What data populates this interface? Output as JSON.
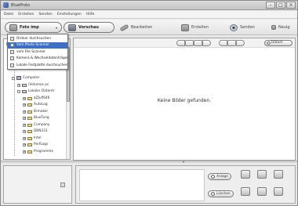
{
  "window": {
    "title": "BlueProto",
    "controls": [
      "–",
      "□",
      "×"
    ]
  },
  "menu": [
    "Datei",
    "Erstellen",
    "Senden",
    "Einstellungen",
    "Hilfe"
  ],
  "toolbar": {
    "import_label": "Foto imp",
    "import_arrow": "▾",
    "view_label": "Vorschau",
    "edit_label": "Bearbeiten",
    "create_label": "Erstellen",
    "send_label": "Senden",
    "more_label": "Neuig"
  },
  "import_menu": [
    {
      "label": "Ordner durchsuchen",
      "selected": false
    },
    {
      "label": "Vom Photo Scanner",
      "selected": true
    },
    {
      "label": "vom File Scanner",
      "selected": false
    },
    {
      "label": "Kamera & Wechseldatenträger",
      "selected": false
    },
    {
      "label": "Lokale Festplatte durchsuchen",
      "selected": false
    }
  ],
  "tree": {
    "computer": "Computer",
    "drive_a": "(Volumes pc",
    "local_disk": "Lokaler Datentr",
    "folders": [
      "$ZJvfl646",
      "AutoLog",
      "Brmaker",
      "BlueTung",
      "Company",
      "DBN331",
      "Intel",
      "PerfLogs",
      "Programme"
    ]
  },
  "view_strip": {
    "sort_label": "Datum"
  },
  "content": {
    "empty_message": "Keine Bilder gefunden."
  },
  "bottom": {
    "divider_arrow": "▾",
    "action_1": "Anlage",
    "action_2": "Löschen"
  }
}
